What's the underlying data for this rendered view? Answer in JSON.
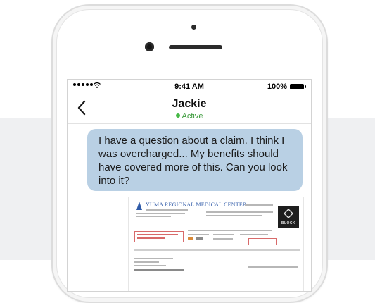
{
  "status_bar": {
    "time": "9:41 AM",
    "battery": "100%"
  },
  "conversation": {
    "contact_name": "Jackie",
    "presence": "Active"
  },
  "message": {
    "text": "I have a question about a claim.  I think I was overcharged...  My benefits should have covered more of this.  Can you look into it?"
  },
  "attachment": {
    "hospital_name": "YUMA REGIONAL MEDICAL CENTER",
    "badge_text": "BLOCK"
  },
  "colors": {
    "bubble": "#b9d0e4",
    "active_green": "#46b946",
    "backdrop": "#eff0f2",
    "back_chevron": "#1c1c1c"
  }
}
